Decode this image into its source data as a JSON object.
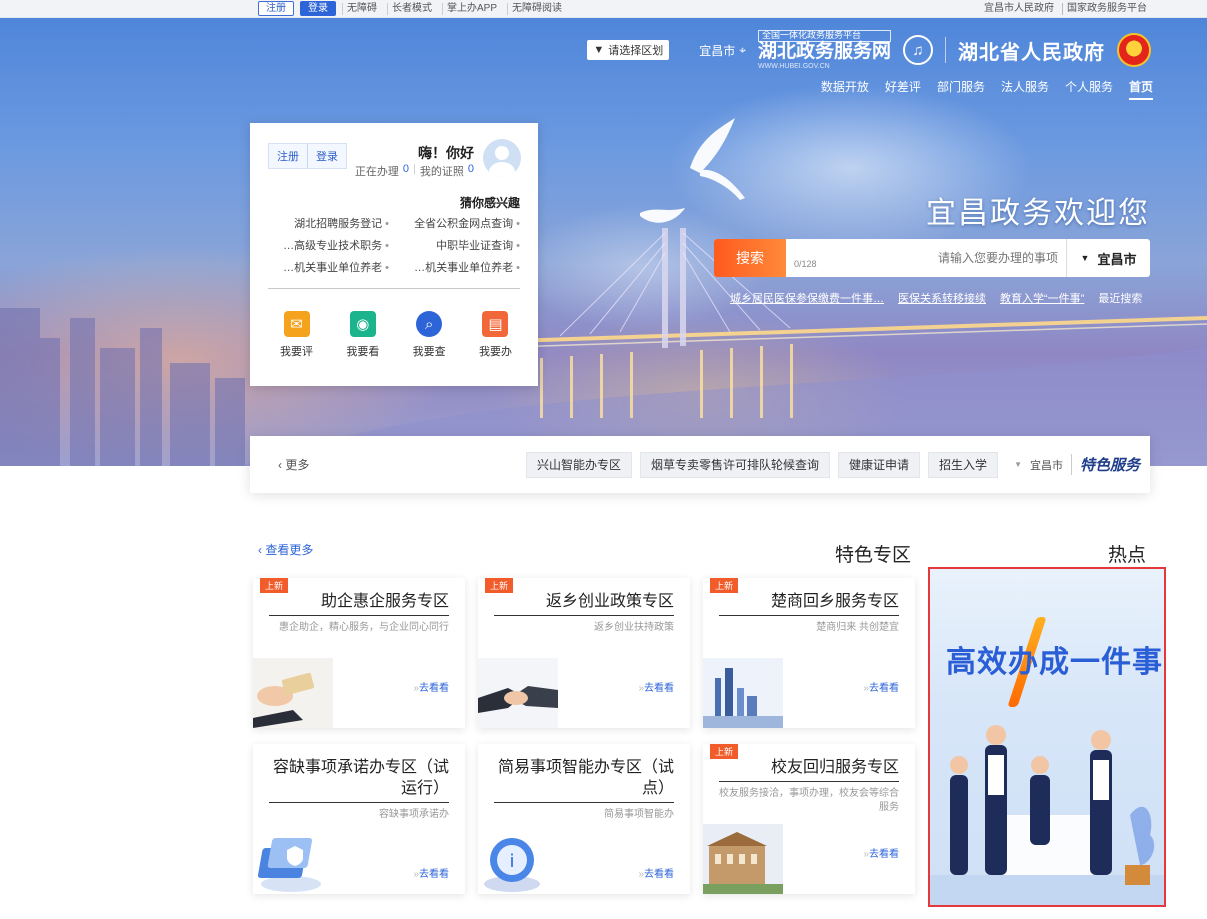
{
  "topbar": {
    "register": "注册",
    "login": "登录",
    "links": [
      "无障碍",
      "长者模式",
      "掌上办APP",
      "无障碍阅读"
    ],
    "right_links": [
      "宜昌市人民政府",
      "国家政务服务平台"
    ]
  },
  "header": {
    "gov_name": "湖北省人民政府",
    "service_platform_tag": "全国一体化政务服务平台",
    "service_name": "湖北政务服务网",
    "service_domain": "WWW.HUBEI.GOV.CN",
    "location": "宜昌市",
    "region_select": "请选择区划"
  },
  "nav": {
    "items": [
      "首页",
      "个人服务",
      "法人服务",
      "部门服务",
      "好差评",
      "数据开放"
    ]
  },
  "hero": {
    "welcome": "宜昌政务欢迎您",
    "search": {
      "city": "宜昌市",
      "placeholder": "请输入您要办理的事项",
      "counter": "0/128",
      "button": "搜索"
    },
    "hot_search": [
      "最近搜索",
      "教育入学“一件事”",
      "医保关系转移接续",
      "城乡居民医保参保缴费一件事…"
    ]
  },
  "login_card": {
    "greeting": "嗨！你好",
    "my_apply_label": "我的证照",
    "my_apply_count": "0",
    "in_progress_label": "正在办理",
    "in_progress_count": "0",
    "login": "登录",
    "register": "注册",
    "section_title": "猜你感兴趣",
    "items": [
      "全省公积金网点查询",
      "湖北招聘服务登记",
      "中职毕业证查询",
      "高级专业技术职务…",
      "机关事业单位养老…",
      "机关事业单位养老…"
    ],
    "actions": [
      {
        "label": "我要办",
        "icon": "briefcase-icon",
        "color": "#f2673a"
      },
      {
        "label": "我要查",
        "icon": "search-icon",
        "color": "#2d64d8"
      },
      {
        "label": "我要看",
        "icon": "eye-icon",
        "color": "#1bb48c"
      },
      {
        "label": "我要评",
        "icon": "chat-icon",
        "color": "#f5a21d"
      }
    ]
  },
  "special_services": {
    "brand": "特色服务",
    "city": "宜昌市",
    "chips": [
      "招生入学",
      "健康证申请",
      "烟草专卖零售许可排队轮候查询",
      "兴山智能办专区"
    ],
    "more": "更多"
  },
  "sections": {
    "hot_title": "热点",
    "feature_title": "特色专区",
    "see_more": "查看更多"
  },
  "hot_banner": {
    "headline": "高效办成一件事"
  },
  "cards": [
    {
      "tag": "上新",
      "title": "楚商回乡服务专区",
      "desc": "楚商归来 共创楚宜",
      "go": "去看看"
    },
    {
      "tag": "上新",
      "title": "返乡创业政策专区",
      "desc": "返乡创业扶持政策",
      "go": "去看看"
    },
    {
      "tag": "上新",
      "title": "助企惠企服务专区",
      "desc": "惠企助企，精心服务，与企业同心同行",
      "go": "去看看"
    },
    {
      "tag": "上新",
      "title": "校友回归服务专区",
      "desc": "校友服务接洽，事项办理，校友会等综合服务",
      "go": "去看看"
    },
    {
      "tag": "",
      "title": "简易事项智能办专区（试点）",
      "desc": "简易事项智能办",
      "go": "去看看"
    },
    {
      "tag": "",
      "title": "容缺事项承诺办专区（试运行）",
      "desc": "容缺事项承诺办",
      "go": "去看看"
    }
  ],
  "colors": {
    "accent": "#2d64d8",
    "search_button": "#ff6a2a",
    "highlight_border": "#e4393c"
  }
}
